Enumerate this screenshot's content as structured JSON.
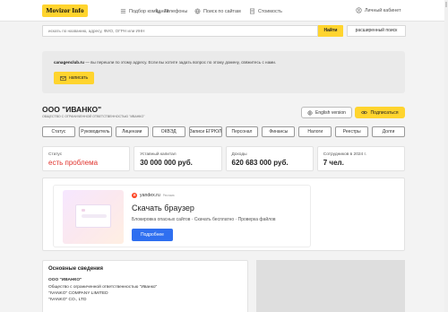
{
  "header": {
    "logo": "Movizor Info",
    "nav": [
      {
        "label": "Подбор компаний",
        "icon": "list-icon"
      },
      {
        "label": "Телефоны",
        "icon": "phone-icon"
      },
      {
        "label": "Поиск по сайтам",
        "icon": "globe-icon"
      },
      {
        "label": "Стоимость",
        "icon": "document-icon"
      }
    ],
    "account": {
      "label": "Личный кабинет",
      "icon": "user-icon"
    }
  },
  "search": {
    "placeholder": "искать по названию, адресу, ФИО, ОГРН или ИНН",
    "button": "Найти",
    "advanced": "расширенный поиск"
  },
  "notice": {
    "site": "canagenclub.ru",
    "text": " — вы перешли по этому адресу. Если вы хотите задать вопрос по этому домену, свяжитесь с нами.",
    "button": "написать"
  },
  "company": {
    "name": "ООО \"ИВАНКО\"",
    "full_name": "общество с ограниченной ответственностью \"иванко\"",
    "english_button": "English version",
    "subscribe_button": "Подписаться"
  },
  "tabs": [
    "Статус",
    "Руководитель",
    "Лицензии",
    "ОКВЭД",
    "Записи ЕГРЮЛ",
    "Персонал",
    "Финансы",
    "Налоги",
    "Реестры",
    "Долги"
  ],
  "stats": [
    {
      "label": "Статус",
      "value": "есть проблема"
    },
    {
      "label": "Уставный капитал",
      "value": "30 000 000 руб."
    },
    {
      "label": "Доходы",
      "value": "620 683 000 руб."
    },
    {
      "label": "Сотрудников в 2024 г.",
      "value": "7 чел."
    }
  ],
  "ad": {
    "brand": "yandex.ru",
    "brand_note": "Реклама",
    "title": "Скачать браузер",
    "description": "Блокировка опасных сайтов · Скачать бесплатно · Проверка файлов",
    "button": "Подробнее"
  },
  "basic_info": {
    "heading": "Основные сведения",
    "short_name": "ООО \"ИВАНКО\"",
    "full_name": "Общество с ограниченной ответственностью \"Иванко\"",
    "en_full": "\"IVANKO\" COMPANY LIMITED",
    "en_short": "\"IVANKO\" CO., LTD"
  },
  "colors": {
    "accent": "#ffd42e",
    "danger": "#e0342f",
    "ad_button": "#2f6ff0"
  }
}
